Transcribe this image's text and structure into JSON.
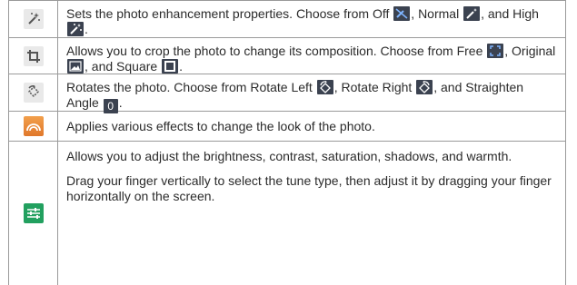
{
  "rows": [
    {
      "icon": "magic-wand-icon",
      "parts": [
        "Sets the photo enhancement properties. Choose from Off ",
        ", Normal ",
        ", and High ",
        "."
      ],
      "inline_icons": [
        "enhance-off-icon",
        "enhance-normal-icon",
        "enhance-high-icon"
      ]
    },
    {
      "icon": "crop-icon",
      "parts": [
        "Allows you to crop the photo to change its composition. Choose from Free ",
        ", Original ",
        ", and Square ",
        "."
      ],
      "inline_icons": [
        "crop-free-icon",
        "crop-original-icon",
        "crop-square-icon"
      ]
    },
    {
      "icon": "rotate-icon",
      "parts": [
        "Rotates the photo. Choose from Rotate Left ",
        ", Rotate Right ",
        ", and Straighten Angle ",
        "."
      ],
      "inline_icons": [
        "rotate-left-icon",
        "rotate-right-icon",
        "straighten-angle-icon"
      ],
      "straighten_value": "0"
    },
    {
      "icon": "effects-icon",
      "text": "Applies various effects to change the look of the photo."
    },
    {
      "icon": "tune-sliders-icon",
      "para1": "Allows you to adjust the brightness, contrast, saturation, shadows, and warmth.",
      "para2": "Drag your finger vertically to select the tune type, then adjust it by dragging your finger horizontally on the screen."
    }
  ]
}
